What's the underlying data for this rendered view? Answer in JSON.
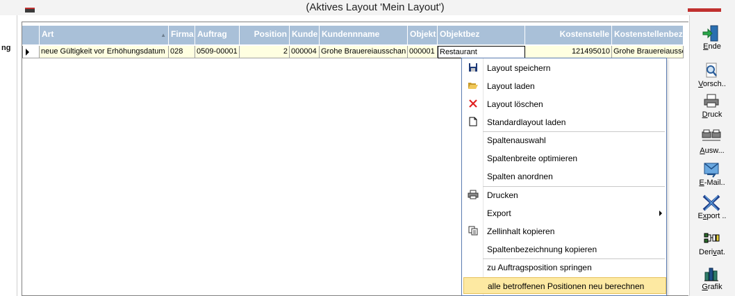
{
  "window": {
    "caption": "(Aktives Layout 'Mein Layout')",
    "left_fragment": "ng"
  },
  "grid": {
    "columns": [
      {
        "label": "Art",
        "align": "left"
      },
      {
        "label": "Firma",
        "align": "left"
      },
      {
        "label": "Auftrag",
        "align": "left"
      },
      {
        "label": "Position",
        "align": "right"
      },
      {
        "label": "Kunde",
        "align": "left"
      },
      {
        "label": "Kundennname",
        "align": "left"
      },
      {
        "label": "Objekt",
        "align": "right"
      },
      {
        "label": "Objektbez",
        "align": "left"
      },
      {
        "label": "Kostenstelle",
        "align": "right"
      },
      {
        "label": "Kostenstellenbez",
        "align": "left"
      }
    ],
    "rows": [
      {
        "cells": [
          "neue Gültigkeit vor Erhöhungsdatum",
          "028",
          "0509-00001",
          "2",
          "000004",
          "Grohe Brauereiausschan",
          "000001",
          "Restaurant",
          "121495010",
          "Grohe Brauereiaussc"
        ]
      }
    ]
  },
  "context_menu": {
    "items": [
      {
        "label": "Layout speichern",
        "icon": "save-icon"
      },
      {
        "label": "Layout laden",
        "icon": "open-folder-icon"
      },
      {
        "label": "Layout löschen",
        "icon": "delete-x-icon"
      },
      {
        "label": "Standardlayout laden",
        "icon": "blank-page-icon"
      },
      {
        "label": "Spaltenauswahl",
        "icon": ""
      },
      {
        "label": "Spaltenbreite optimieren",
        "icon": ""
      },
      {
        "label": "Spalten anordnen",
        "icon": ""
      },
      {
        "label": "Drucken",
        "icon": "printer-icon"
      },
      {
        "label": "Export",
        "icon": "",
        "submenu": true
      },
      {
        "label": "Zellinhalt kopieren",
        "icon": "copy-icon"
      },
      {
        "label": "Spaltenbezeichnung kopieren",
        "icon": ""
      },
      {
        "label": "zu Auftragsposition springen",
        "icon": ""
      },
      {
        "label": "alle betroffenen Positionen neu berechnen",
        "icon": "",
        "highlighted": true
      }
    ]
  },
  "toolbar": {
    "buttons": [
      {
        "label": "Ende",
        "underline": "E",
        "rest": "nde",
        "icon": "exit-door-icon"
      },
      {
        "label": "Vorsch..",
        "underline": "V",
        "rest": "orsch..",
        "icon": "magnifier-icon"
      },
      {
        "label": "Druck",
        "underline": "D",
        "rest": "ruck",
        "icon": "printer-icon"
      },
      {
        "label": "Ausw...",
        "underline": "A",
        "rest": "usw...",
        "icon": "multi-printer-icon"
      },
      {
        "label": "E-Mail..",
        "underline": "E",
        "rest": "-Mail..",
        "icon": "email-icon"
      },
      {
        "label": "Export ..",
        "underline": "x",
        "pre": "E",
        "rest": "port ..",
        "icon": "export-icon"
      },
      {
        "label": "Derivat.",
        "underline": "v",
        "pre": "Deri",
        "rest": "at.",
        "icon": "derivat-icon"
      },
      {
        "label": "Grafik",
        "underline": "G",
        "rest": "rafik",
        "icon": "chart-icon"
      }
    ]
  },
  "colors": {
    "header_bg": "#a9c0d8",
    "row_bg": "#ffffe1",
    "menu_highlight": "#fde9a2",
    "accent_red": "#c0302e"
  }
}
